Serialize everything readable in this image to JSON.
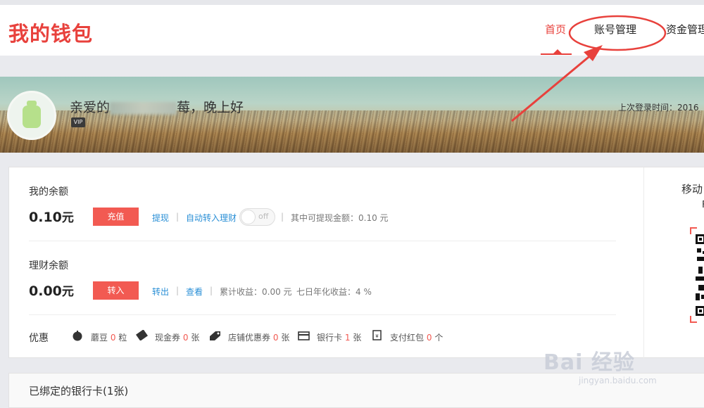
{
  "header": {
    "logo": "我的钱包",
    "nav": [
      "首页",
      "账号管理",
      "资金管理"
    ]
  },
  "banner": {
    "greeting_prefix": "亲爱的",
    "greeting_suffix": "莓，晚上好",
    "vip_badge": "VIP",
    "last_login": "上次登录时间：2016"
  },
  "balance": {
    "label": "我的余额",
    "amount": "0.10",
    "unit": "元",
    "recharge": "充值",
    "withdraw": "提现",
    "auto_transfer": "自动转入理财",
    "toggle_state": "off",
    "withdrawable": "其中可提现金额：0.10 元"
  },
  "finance": {
    "label": "理财余额",
    "amount": "0.00",
    "unit": "元",
    "transfer_in": "转入",
    "transfer_out": "转出",
    "view": "查看",
    "cumulative": "累计收益：0.00 元",
    "annual": "七日年化收益：4 %"
  },
  "perks": {
    "label": "优惠",
    "items": [
      {
        "name": "蘑豆",
        "count": "0",
        "unit": "粒",
        "icon": "bean-icon"
      },
      {
        "name": "现金券",
        "count": "0",
        "unit": "张",
        "icon": "ticket-icon"
      },
      {
        "name": "店铺优惠券",
        "count": "0",
        "unit": "张",
        "icon": "tag-icon"
      },
      {
        "name": "银行卡",
        "count": "1",
        "unit": "张",
        "icon": "card-icon"
      },
      {
        "name": "支付红包",
        "count": "0",
        "unit": "个",
        "icon": "envelope-icon"
      }
    ]
  },
  "sidebox": {
    "title": "移动",
    "sub": "F"
  },
  "bank_cards": {
    "title": "已绑定的银行卡(1张)"
  },
  "watermark": {
    "brand": "Bai 经验",
    "url": "jingyan.baidu.com"
  },
  "colors": {
    "accent": "#e8413c",
    "link": "#2a8fd6",
    "button": "#f25a52"
  }
}
